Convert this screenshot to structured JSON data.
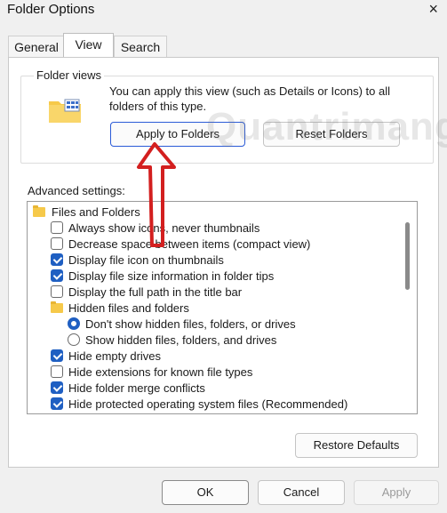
{
  "window": {
    "title": "Folder Options",
    "close_glyph": "×"
  },
  "tabs": [
    {
      "label": "General"
    },
    {
      "label": "View",
      "active": true
    },
    {
      "label": "Search"
    }
  ],
  "folder_views": {
    "title": "Folder views",
    "description": "You can apply this view (such as Details or Icons) to all folders of this type.",
    "apply_label": "Apply to Folders",
    "reset_label": "Reset Folders"
  },
  "advanced": {
    "label": "Advanced settings:",
    "items": [
      {
        "type": "folder",
        "label": "Files and Folders"
      },
      {
        "type": "checkbox",
        "label": "Always show icons, never thumbnails",
        "checked": false
      },
      {
        "type": "checkbox",
        "label": "Decrease space between items (compact view)",
        "checked": false
      },
      {
        "type": "checkbox",
        "label": "Display file icon on thumbnails",
        "checked": true
      },
      {
        "type": "checkbox",
        "label": "Display file size information in folder tips",
        "checked": true
      },
      {
        "type": "checkbox",
        "label": "Display the full path in the title bar",
        "checked": false
      },
      {
        "type": "folder",
        "label": "Hidden files and folders"
      },
      {
        "type": "radio",
        "label": "Don't show hidden files, folders, or drives",
        "checked": true
      },
      {
        "type": "radio",
        "label": "Show hidden files, folders, and drives",
        "checked": false
      },
      {
        "type": "checkbox",
        "label": "Hide empty drives",
        "checked": true
      },
      {
        "type": "checkbox",
        "label": "Hide extensions for known file types",
        "checked": false
      },
      {
        "type": "checkbox",
        "label": "Hide folder merge conflicts",
        "checked": true
      },
      {
        "type": "checkbox",
        "label": "Hide protected operating system files (Recommended)",
        "checked": true
      }
    ]
  },
  "restore_label": "Restore Defaults",
  "footer": {
    "ok_label": "OK",
    "cancel_label": "Cancel",
    "apply_label": "Apply"
  },
  "watermark": "Quantrimang",
  "colors": {
    "accent": "#1f5fc2",
    "arrow": "#d31f1f",
    "focus_border": "#2b5bd7"
  },
  "icons": {
    "close": "close-icon",
    "folder_views": "folder-views-icon",
    "folder": "folder-icon"
  }
}
